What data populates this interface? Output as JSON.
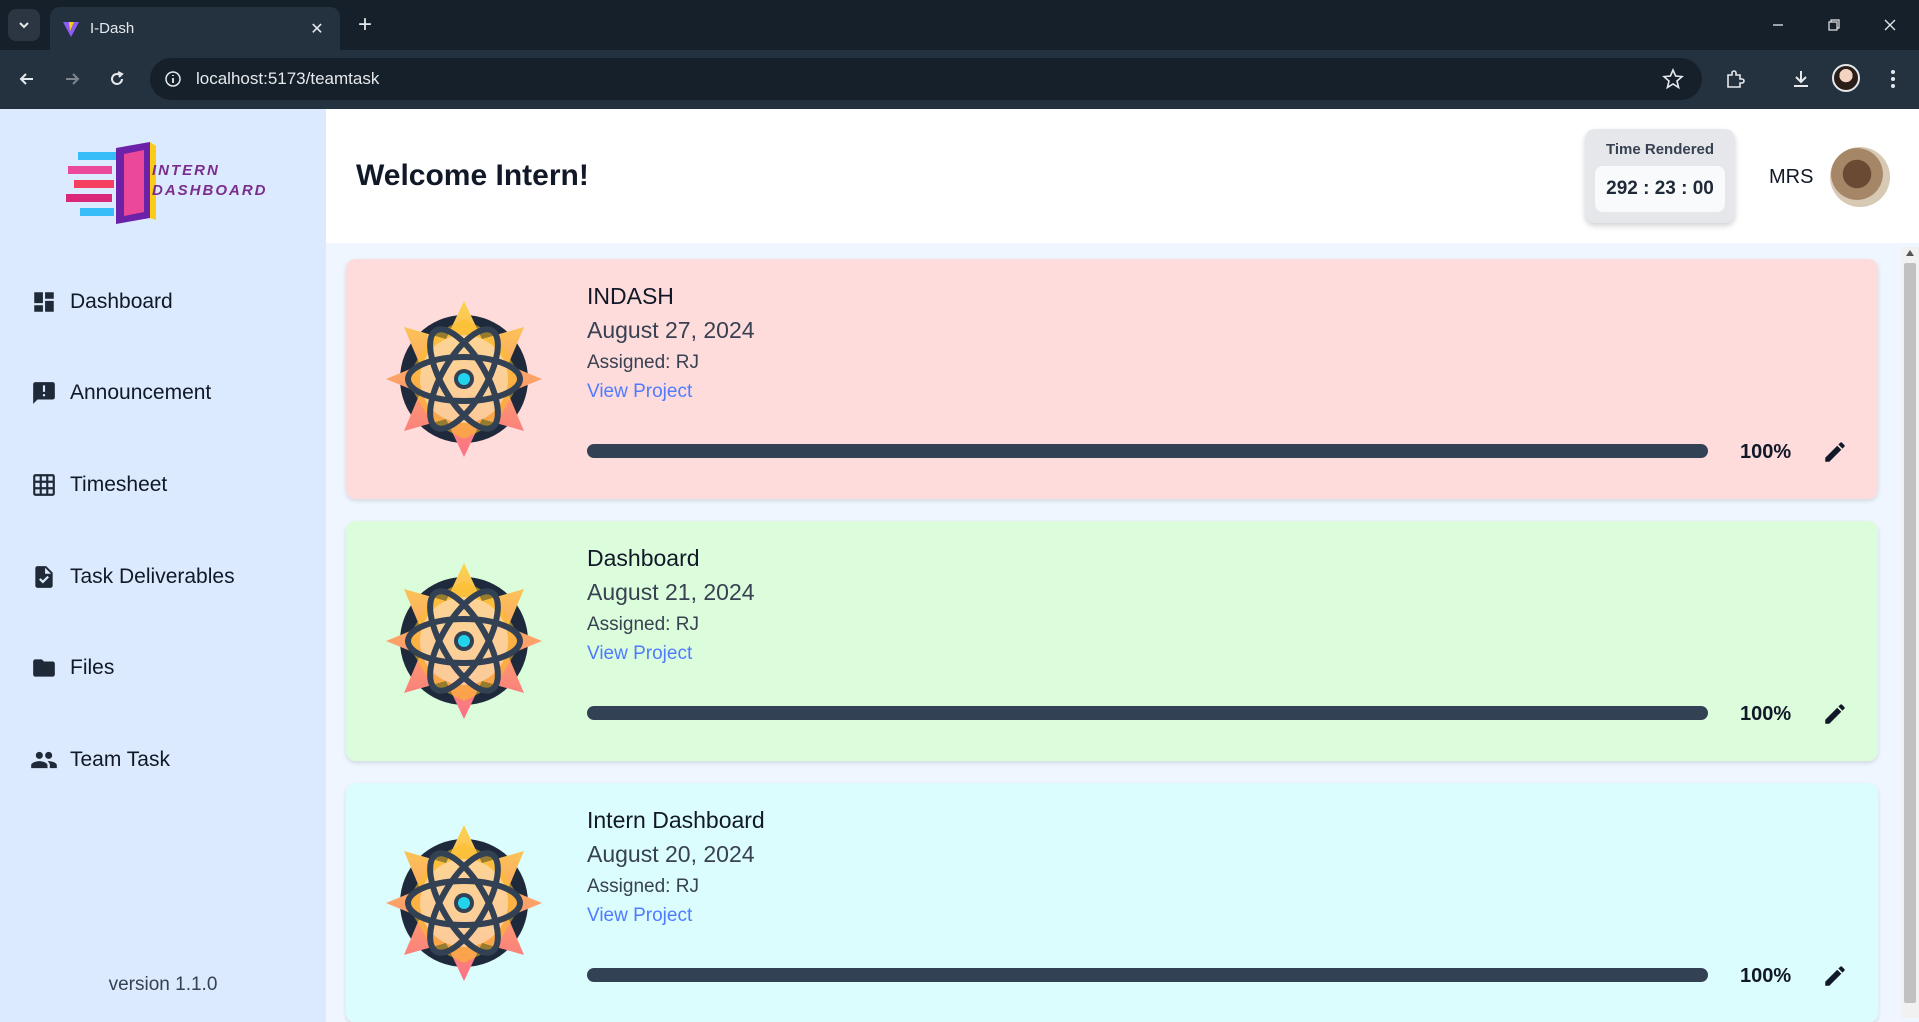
{
  "browser": {
    "tab_title": "I-Dash",
    "url": "localhost:5173/teamtask"
  },
  "sidebar": {
    "logo_text_line1": "INTERN",
    "logo_text_line2": "DASHBOARD",
    "items": [
      {
        "label": "Dashboard",
        "icon": "dashboard-icon"
      },
      {
        "label": "Announcement",
        "icon": "announcement-icon"
      },
      {
        "label": "Timesheet",
        "icon": "grid-icon"
      },
      {
        "label": "Task Deliverables",
        "icon": "task-file-icon"
      },
      {
        "label": "Files",
        "icon": "folder-icon"
      },
      {
        "label": "Team Task",
        "icon": "team-icon"
      }
    ],
    "version": "version 1.1.0"
  },
  "header": {
    "welcome": "Welcome Intern!",
    "time_label": "Time Rendered",
    "time_value": "292 : 23 : 00",
    "user_name": "MRS"
  },
  "projects": [
    {
      "title": "INDASH",
      "date": "August 27, 2024",
      "assigned": "Assigned: RJ",
      "link": "View Project",
      "progress": 1.0,
      "progress_text": "100%",
      "bg": "#fedcdc"
    },
    {
      "title": "Dashboard",
      "date": "August 21, 2024",
      "assigned": "Assigned: RJ",
      "link": "View Project",
      "progress": 1.0,
      "progress_text": "100%",
      "bg": "#dcfddc"
    },
    {
      "title": "Intern Dashboard",
      "date": "August 20, 2024",
      "assigned": "Assigned: RJ",
      "link": "View Project",
      "progress": 1.0,
      "progress_text": "100%",
      "bg": "#dcfdfd"
    }
  ]
}
